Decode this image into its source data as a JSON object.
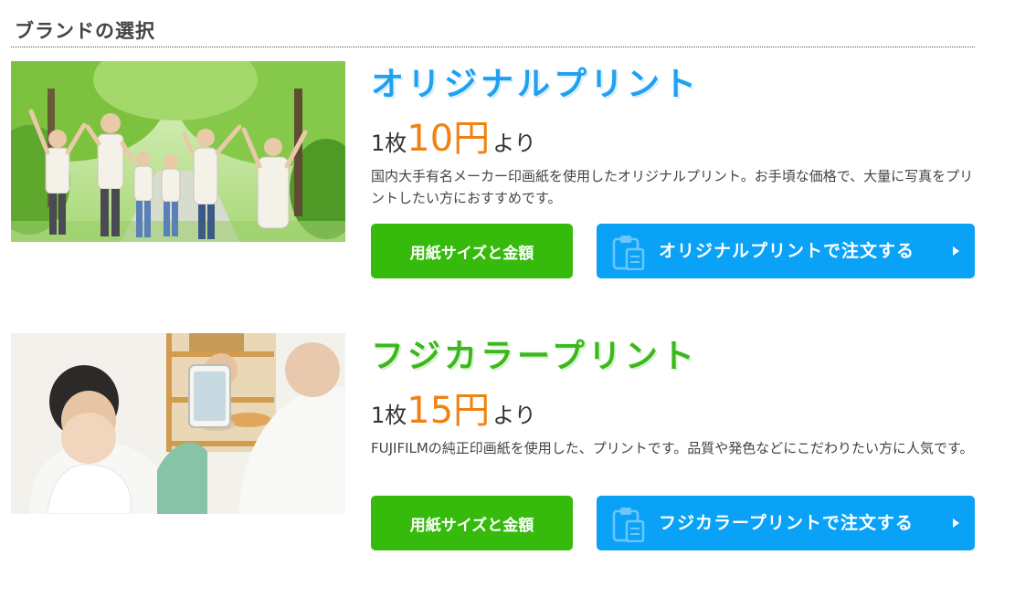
{
  "section": {
    "title": "ブランドの選択"
  },
  "brands": [
    {
      "name": "オリジナルプリント",
      "price_unit": "1枚",
      "price_amount": "10円",
      "price_suffix": "より",
      "description": "国内大手有名メーカー印画紙を使用したオリジナルプリント。お手頃な価格で、大量に写真をプリントしたい方におすすめです。",
      "size_button": "用紙サイズと金額",
      "order_button": "オリジナルプリントで注文する",
      "name_color": "#1fa0f0"
    },
    {
      "name": "フジカラープリント",
      "price_unit": "1枚",
      "price_amount": "15円",
      "price_suffix": "より",
      "description": "FUJIFILMの純正印画紙を使用した、プリントです。品質や発色などにこだわりたい方に人気です。",
      "size_button": "用紙サイズと金額",
      "order_button": "フジカラープリントで注文する",
      "name_color": "#3ab81c"
    }
  ],
  "colors": {
    "green_button": "#36bb0c",
    "blue_button": "#0aa2f7",
    "price": "#f08214"
  },
  "icons": {
    "order": "clipboard-icon",
    "arrow": "triangle-right-icon"
  }
}
